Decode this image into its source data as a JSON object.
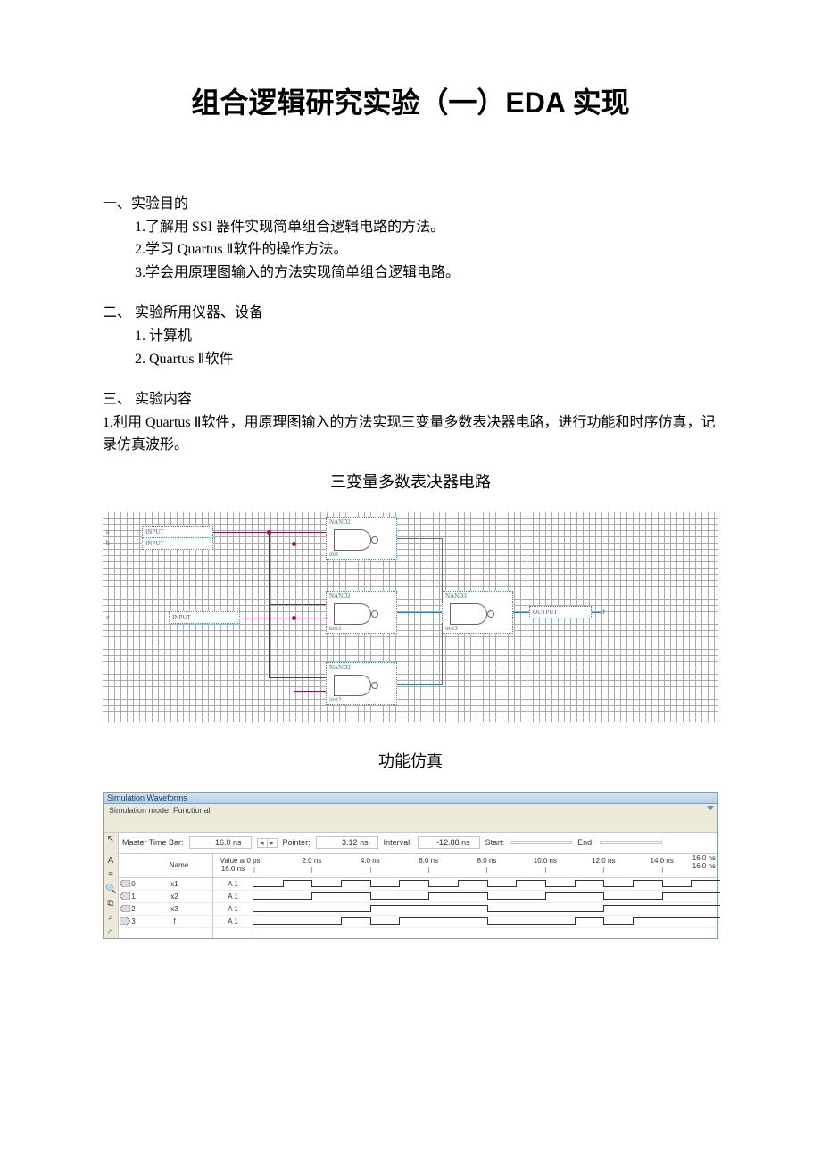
{
  "title": "组合逻辑研究实验（一）EDA 实现",
  "sections": {
    "s1": {
      "head": "一、实验目的",
      "items": [
        "1.了解用 SSI 器件实现简单组合逻辑电路的方法。",
        "2.学习 Quartus Ⅱ软件的操作方法。",
        "3.学会用原理图输入的方法实现简单组合逻辑电路。"
      ]
    },
    "s2": {
      "head": "二、 实验所用仪器、设备",
      "items": [
        "1. 计算机",
        "2. Quartus Ⅱ软件"
      ]
    },
    "s3": {
      "head": "三、 实验内容",
      "para": "1.利用 Quartus Ⅱ软件，用原理图输入的方法实现三变量多数表决器电路，进行功能和时序仿真，记录仿真波形。"
    }
  },
  "subtitle1": "三变量多数表决器电路",
  "subtitle2": "功能仿真",
  "circuit": {
    "inputs": [
      {
        "label": "a",
        "io": "INPUT"
      },
      {
        "label": "b",
        "io": "INPUT"
      },
      {
        "label": "c",
        "io": "INPUT"
      }
    ],
    "output": {
      "label": "f",
      "io": "OUTPUT"
    },
    "gates": [
      {
        "type": "NAND2",
        "inst": "inst"
      },
      {
        "type": "NAND2",
        "inst": "inst1"
      },
      {
        "type": "NAND2",
        "inst": "inst2"
      },
      {
        "type": "NAND3",
        "inst": "inst3"
      }
    ]
  },
  "waveform": {
    "title": "Simulation Waveforms",
    "mode": "Simulation mode: Functional",
    "master_bar_label": "Master Time Bar:",
    "master_bar_val": "16.0 ns",
    "pointer_label": "Pointer:",
    "pointer_val": "3.12 ns",
    "interval_label": "Interval:",
    "interval_val": "-12.88 ns",
    "start_label": "Start:",
    "start_val": "",
    "end_label": "End:",
    "end_val": "",
    "name_head": "Name",
    "value_head": "Value at\n16.0 ns",
    "ticks": [
      "0 ps",
      "2.0 ns",
      "4.0 ns",
      "6.0 ns",
      "8.0 ns",
      "10.0 ns",
      "12.0 ns",
      "14.0 ns"
    ],
    "end_tick_top": "16.0 ns",
    "end_tick_bot": "16.0 ns",
    "signals": [
      {
        "idx": "0",
        "name": "x1",
        "value": "A 1",
        "dir": "in"
      },
      {
        "idx": "1",
        "name": "x2",
        "value": "A 1",
        "dir": "in"
      },
      {
        "idx": "2",
        "name": "x3",
        "value": "A 1",
        "dir": "in"
      },
      {
        "idx": "3",
        "name": "f",
        "value": "A 1",
        "dir": "out"
      }
    ],
    "chart_data": {
      "type": "table",
      "time_ns": [
        0,
        1,
        2,
        3,
        4,
        5,
        6,
        7,
        8,
        9,
        10,
        11,
        12,
        13,
        14,
        15
      ],
      "x1": [
        0,
        1,
        0,
        1,
        0,
        1,
        0,
        1,
        0,
        1,
        0,
        1,
        0,
        1,
        0,
        1
      ],
      "x2": [
        0,
        0,
        1,
        1,
        0,
        0,
        1,
        1,
        0,
        0,
        1,
        1,
        0,
        0,
        1,
        1
      ],
      "x3": [
        0,
        0,
        0,
        0,
        1,
        1,
        1,
        1,
        0,
        0,
        0,
        0,
        1,
        1,
        1,
        1
      ],
      "f": [
        0,
        0,
        0,
        1,
        0,
        1,
        1,
        1,
        0,
        0,
        0,
        1,
        0,
        1,
        1,
        1
      ]
    }
  }
}
